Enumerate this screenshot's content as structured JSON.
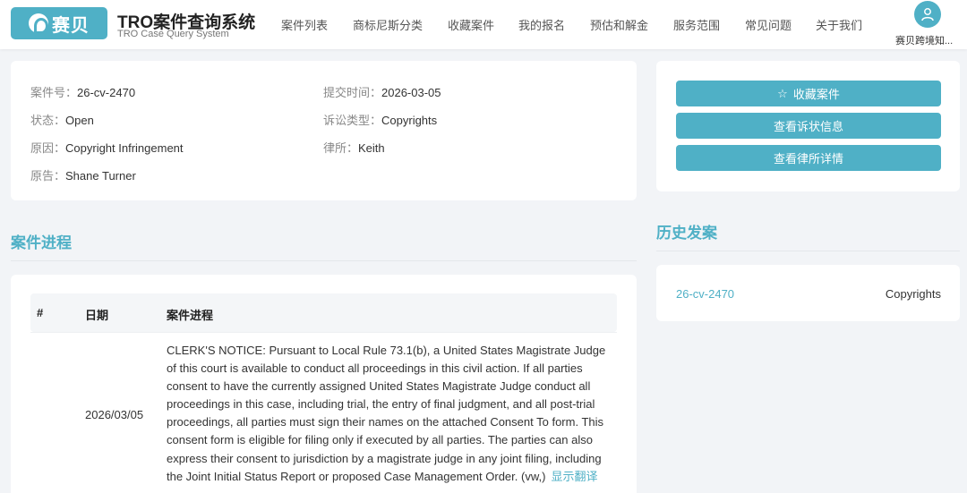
{
  "header": {
    "logo_text": "赛贝",
    "title": "TRO案件查询系统",
    "subtitle": "TRO Case Query System",
    "nav": [
      "案件列表",
      "商标尼斯分类",
      "收藏案件",
      "我的报名",
      "预估和解金",
      "服务范围",
      "常见问题",
      "关于我们"
    ],
    "user_name": "赛贝跨境知...",
    "avatar_icon": "user-icon"
  },
  "case_info": {
    "case_no_label": "案件号：",
    "case_no": "26-cv-2470",
    "filed_label": "提交时间：",
    "filed": "2026-03-05",
    "status_label": "状态：",
    "status": "Open",
    "type_label": "诉讼类型：",
    "type": "Copyrights",
    "cause_label": "原因：",
    "cause": "Copyright Infringement",
    "firm_label": "律所：",
    "firm": "Keith",
    "plaintiff_label": "原告：",
    "plaintiff": "Shane Turner"
  },
  "actions": {
    "favorite": "收藏案件",
    "complaint": "查看诉状信息",
    "firm_detail": "查看律所详情",
    "favorite_icon": "star-icon"
  },
  "history": {
    "title": "历史发案",
    "items": [
      {
        "case_no": "26-cv-2470",
        "type": "Copyrights"
      }
    ]
  },
  "progress": {
    "title": "案件进程",
    "columns": [
      "#",
      "日期",
      "案件进程"
    ],
    "rows": [
      {
        "date": "2026/03/05",
        "text": "CLERK'S NOTICE: Pursuant to Local Rule 73.1(b), a United States Magistrate Judge of this court is available to conduct all proceedings in this civil action. If all parties consent to have the currently assigned United States Magistrate Judge conduct all proceedings in this case, including trial, the entry of final judgment, and all post-trial proceedings, all parties must sign their names on the attached Consent To form. This consent form is eligible for filing only if executed by all parties. The parties can also express their consent to jurisdiction by a magistrate judge in any joint filing, including the Joint Initial Status Report or proposed Case Management Order. (vw,)",
        "translate": "显示翻译"
      }
    ]
  },
  "colors": {
    "accent": "#4fb0c6",
    "background": "#f2f4f7"
  }
}
